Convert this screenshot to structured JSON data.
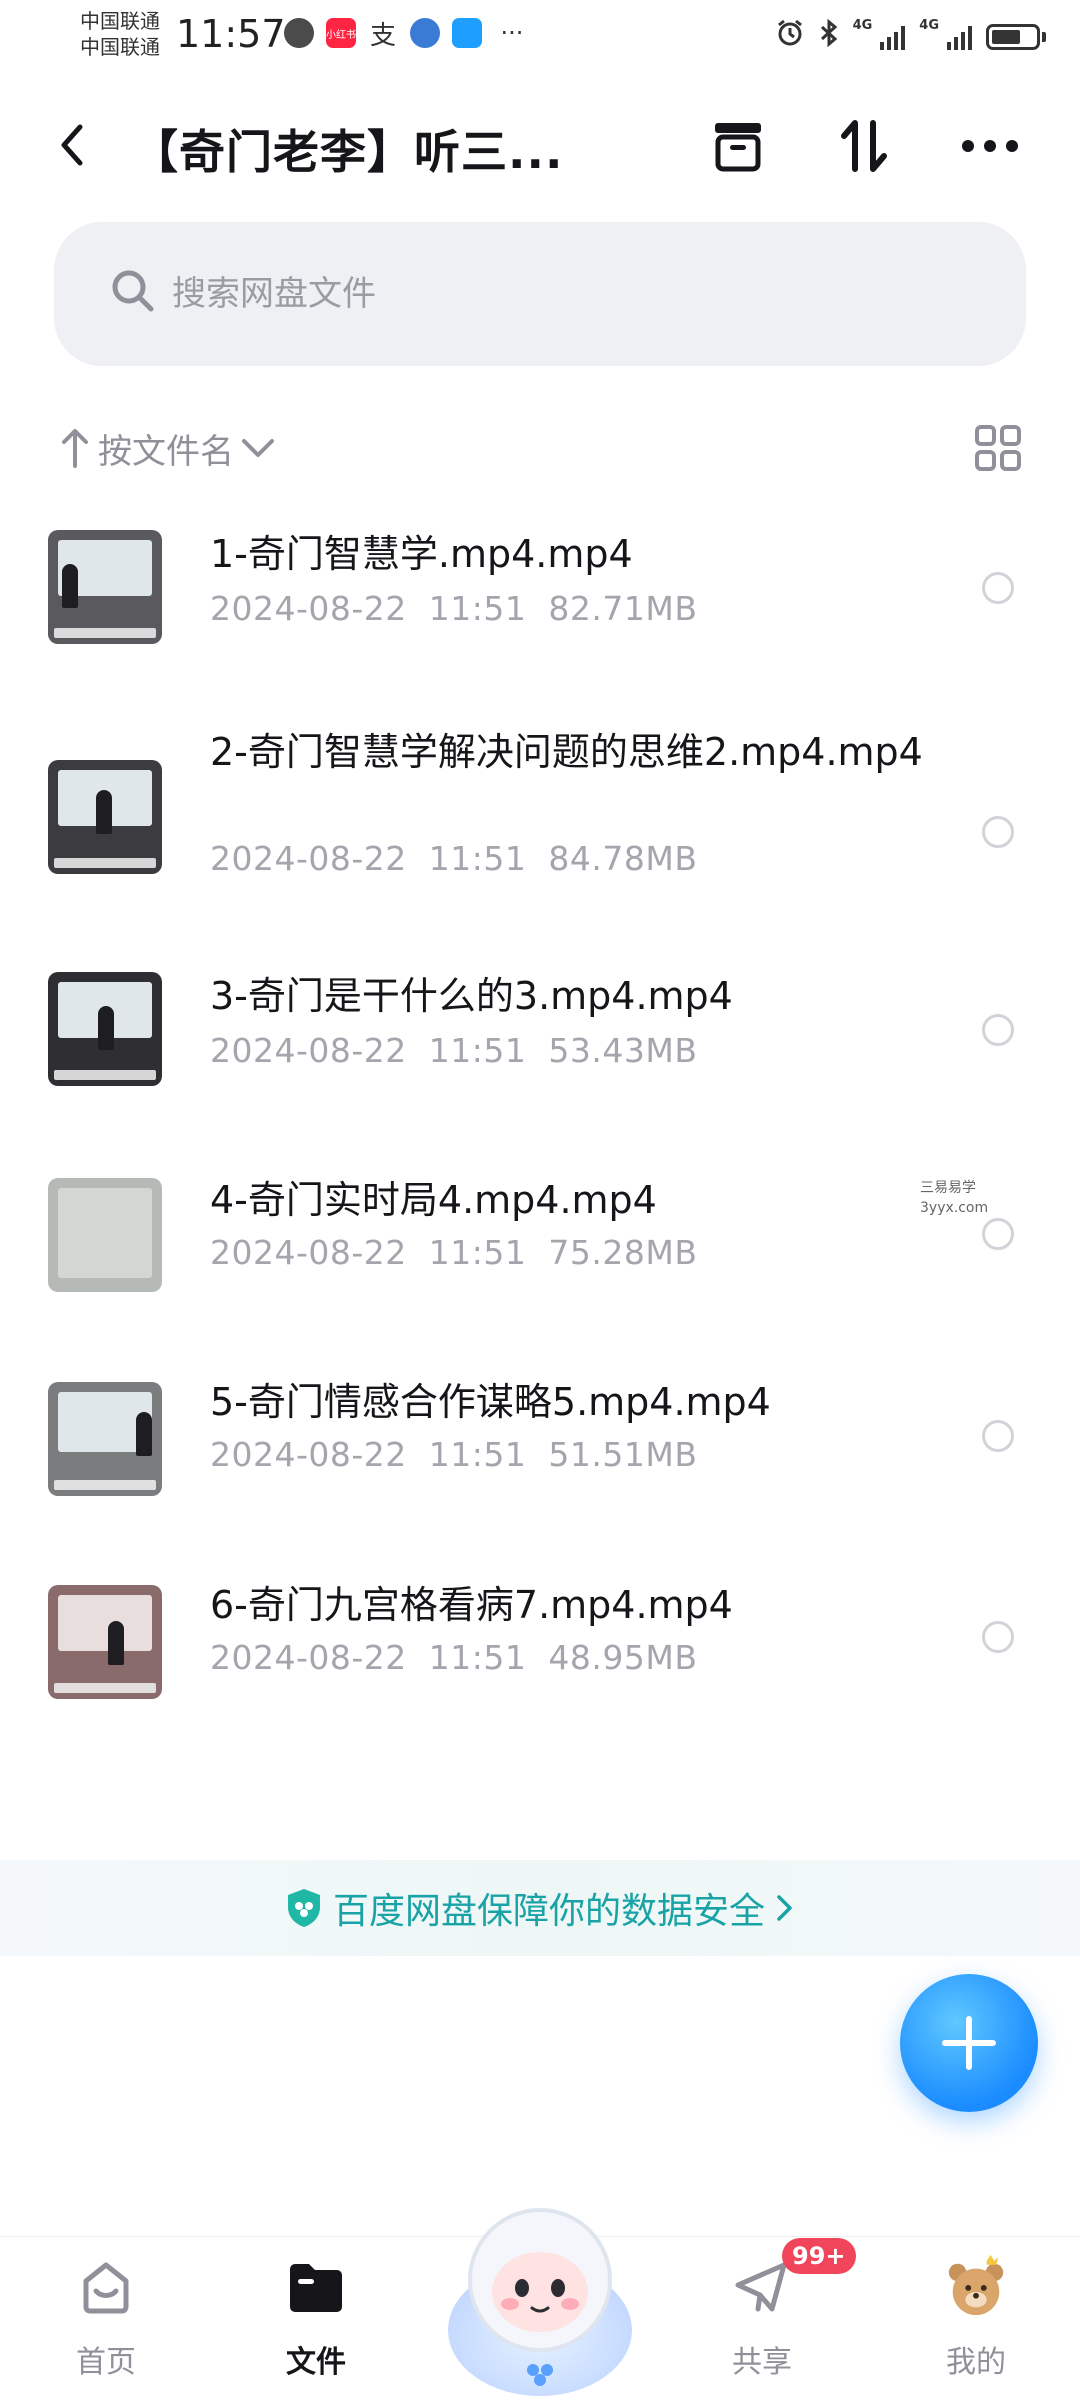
{
  "status_bar": {
    "carrier_1": "中国联通",
    "carrier_2": "中国联通",
    "time": "11:57",
    "network_1": "4G",
    "network_2": "4G",
    "app_badge_red": "小红书"
  },
  "header": {
    "title": "【奇门老李】听三...",
    "icons": [
      "back-icon",
      "archive-icon",
      "sort-swap-icon",
      "more-icon"
    ]
  },
  "search": {
    "placeholder": "搜索网盘文件"
  },
  "sort": {
    "label": "按文件名"
  },
  "files": [
    {
      "name": "1-奇门智慧学.mp4.mp4",
      "date": "2024-08-22",
      "time": "11:51",
      "size": "82.71MB"
    },
    {
      "name": "2-奇门智慧学解决问题的思维2.mp4.mp4",
      "date": "2024-08-22",
      "time": "11:51",
      "size": "84.78MB"
    },
    {
      "name": "3-奇门是干什么的3.mp4.mp4",
      "date": "2024-08-22",
      "time": "11:51",
      "size": "53.43MB"
    },
    {
      "name": "4-奇门实时局4.mp4.mp4",
      "date": "2024-08-22",
      "time": "11:51",
      "size": "75.28MB"
    },
    {
      "name": "5-奇门情感合作谋略5.mp4.mp4",
      "date": "2024-08-22",
      "time": "11:51",
      "size": "51.51MB"
    },
    {
      "name": "6-奇门九宫格看病7.mp4.mp4",
      "date": "2024-08-22",
      "time": "11:51",
      "size": "48.95MB"
    }
  ],
  "watermark": {
    "line1": "三易易学",
    "line2": "3yyx.com"
  },
  "security_banner": {
    "text": "百度网盘保障你的数据安全"
  },
  "bottom_nav": {
    "items": [
      {
        "label": "首页"
      },
      {
        "label": "文件"
      },
      {
        "label": "共享"
      },
      {
        "label": "我的"
      }
    ],
    "share_badge": "99+"
  },
  "colors": {
    "accent": "#1a8cff",
    "banner_text": "#1aa3a6",
    "badge": "#f0455a"
  }
}
